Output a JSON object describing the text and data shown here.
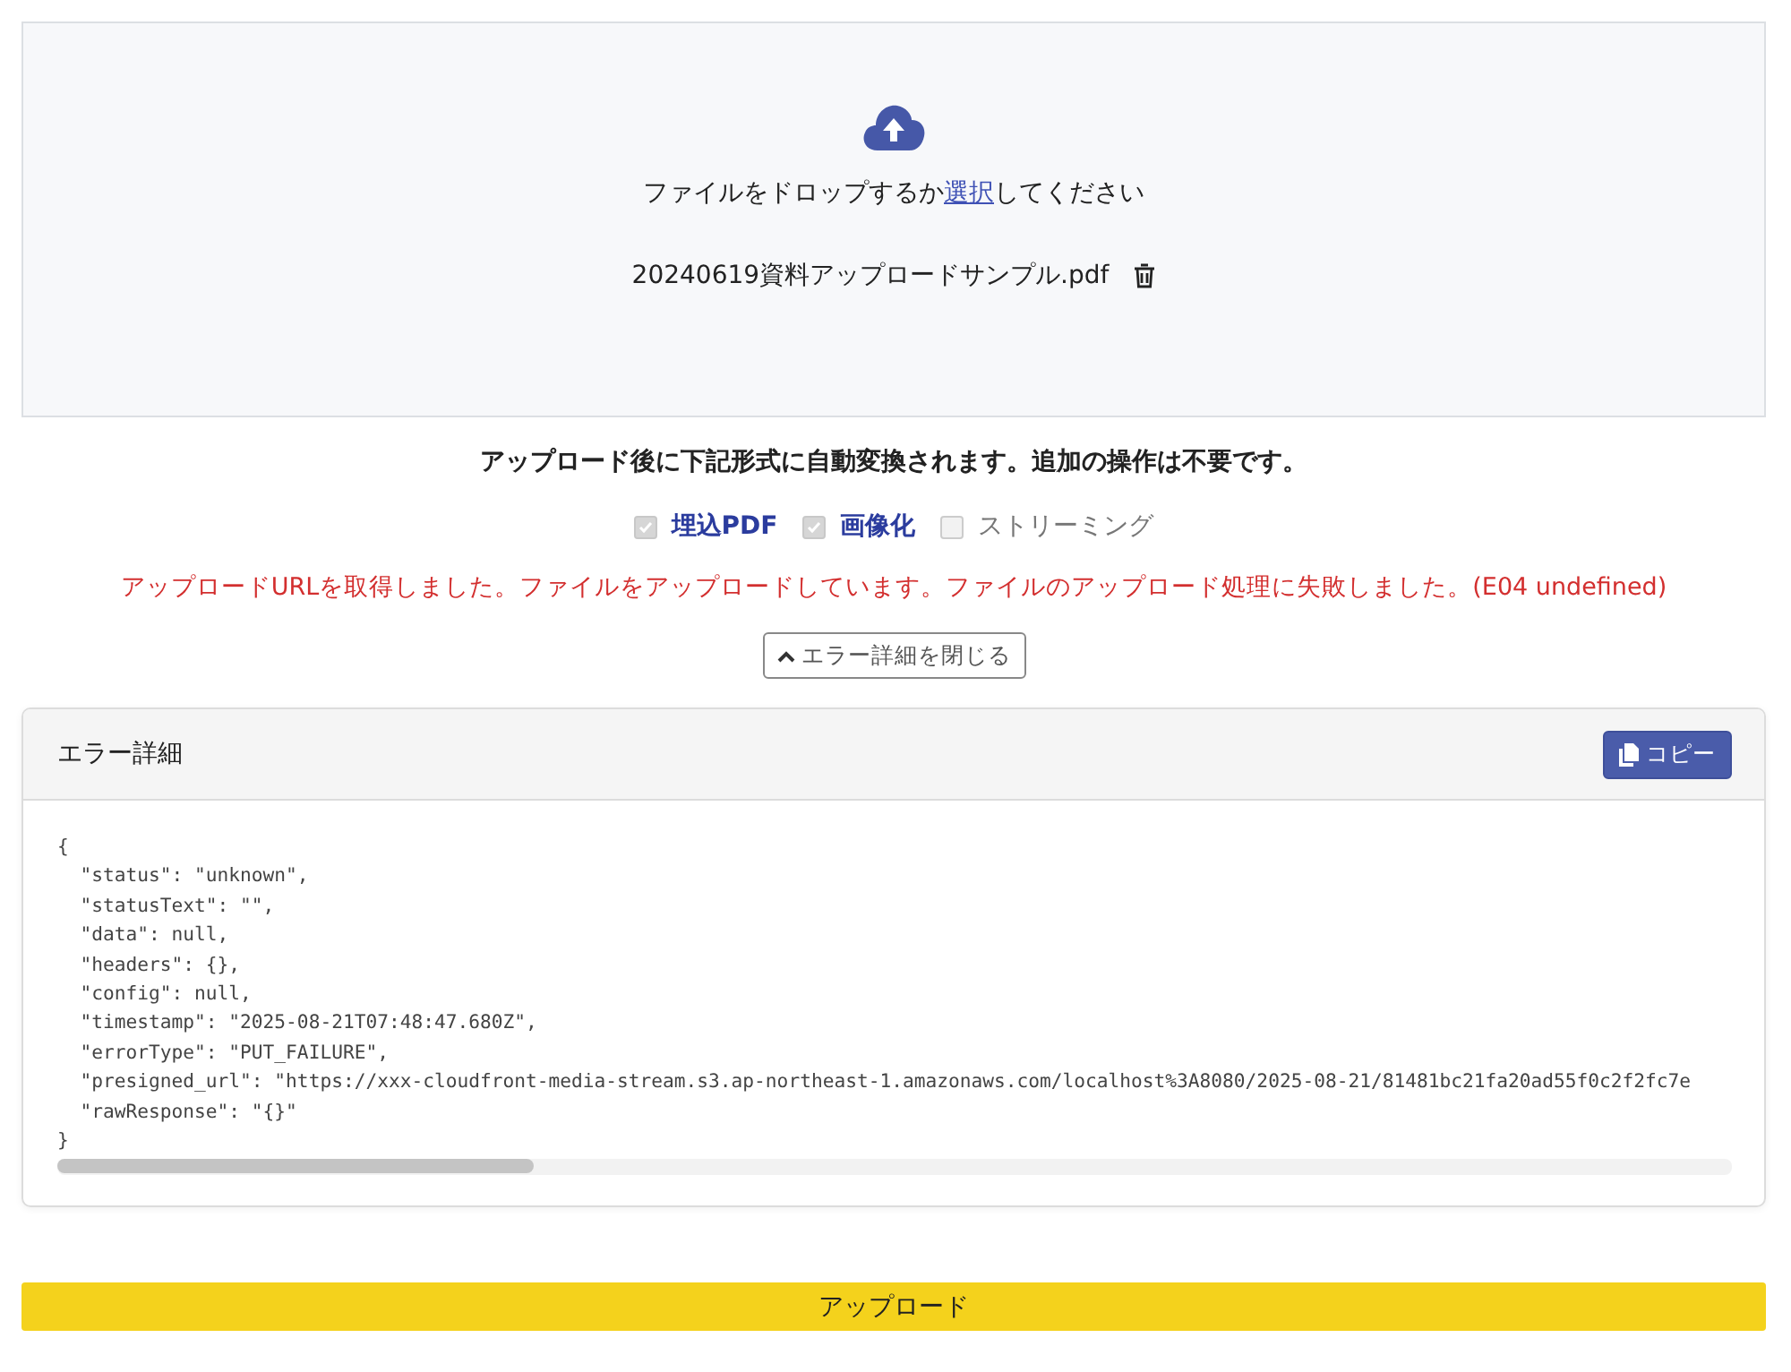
{
  "dropzone": {
    "prompt_before": "ファイルをドロップするか",
    "prompt_link": "選択",
    "prompt_after": "してください",
    "file_name": "20240619資料アップロードサンプル.pdf"
  },
  "notice": "アップロード後に下記形式に自動変換されます。追加の操作は不要です。",
  "formats": [
    {
      "label": "埋込PDF",
      "checked": true
    },
    {
      "label": "画像化",
      "checked": true
    },
    {
      "label": "ストリーミング",
      "checked": false
    }
  ],
  "error_message": "アップロードURLを取得しました。ファイルをアップロードしています。ファイルのアップロード処理に失敗しました。(E04 undefined)",
  "toggle_button": "エラー詳細を閉じる",
  "error_panel": {
    "title": "エラー詳細",
    "copy_button": "コピー",
    "code_lines": [
      "{",
      "  \"status\": \"unknown\",",
      "  \"statusText\": \"\",",
      "  \"data\": null,",
      "  \"headers\": {},",
      "  \"config\": null,",
      "  \"timestamp\": \"2025-08-21T07:48:47.680Z\",",
      "  \"errorType\": \"PUT_FAILURE\",",
      "  \"presigned_url\": \"https://xxx-cloudfront-media-stream.s3.ap-northeast-1.amazonaws.com/localhost%3A8080/2025-08-21/81481bc21fa20ad55f0c2f2fc7e",
      "  \"rawResponse\": \"{}\"",
      "}"
    ]
  },
  "upload_button": "アップロード"
}
